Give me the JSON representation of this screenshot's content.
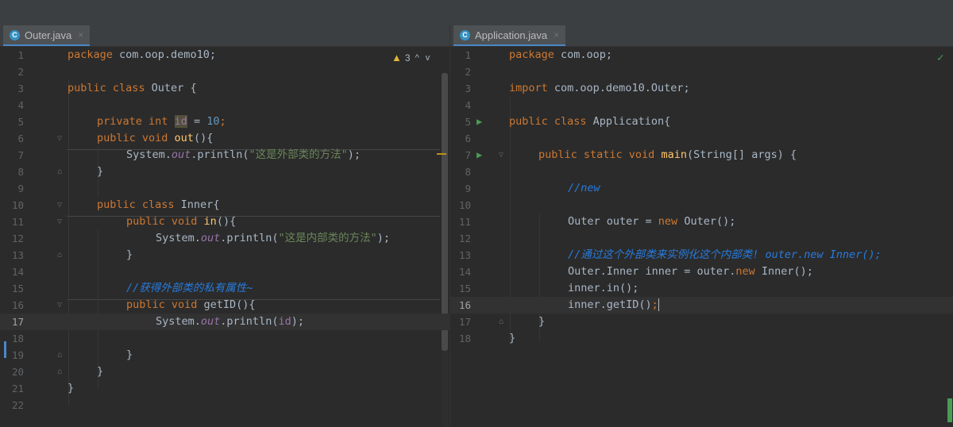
{
  "left_tab": {
    "icon": "C",
    "title": "Outer.java",
    "close": "×"
  },
  "right_tab": {
    "icon": "C",
    "title": "Application.java",
    "close": "×"
  },
  "left_status": {
    "warning_count": "3",
    "up": "^",
    "down": "v"
  },
  "right_status": {
    "check": "✓"
  },
  "left_code": {
    "line_numbers": [
      "1",
      "2",
      "3",
      "4",
      "5",
      "6",
      "7",
      "8",
      "9",
      "10",
      "11",
      "12",
      "13",
      "14",
      "15",
      "16",
      "17",
      "18",
      "19",
      "20",
      "21",
      "22"
    ],
    "l1_kw": "package",
    "l1_rest": " com.oop.demo10;",
    "l3_kw": "public class",
    "l3_rest": " Outer {",
    "l5_kw": "private int",
    "l5_field": "id",
    "l5_eq": " = ",
    "l5_num": "10",
    "l5_end": ";",
    "l6_kw": "public void",
    "l6_fn": "out",
    "l6_end": "(){",
    "l7_a": "System.",
    "l7_out": "out",
    "l7_b": ".println(",
    "l7_str": "\"这是外部类的方法\"",
    "l7_c": ");",
    "l8": "}",
    "l10_kw": "public class",
    "l10_rest": " Inner{",
    "l11_kw": "public void",
    "l11_fn": "in",
    "l11_end": "(){",
    "l12_a": "System.",
    "l12_out": "out",
    "l12_b": ".println(",
    "l12_str": "\"这是内部类的方法\"",
    "l12_c": ");",
    "l13": "}",
    "l15_cmt": "//获得外部类的私有属性~",
    "l16_kw": "public void",
    "l16_rest": " getID(){",
    "l17_a": "System.",
    "l17_out": "out",
    "l17_b": ".println(",
    "l17_field": "id",
    "l17_c": ");",
    "l19": "}",
    "l20": "}",
    "l21": "}"
  },
  "right_code": {
    "line_numbers": [
      "1",
      "2",
      "3",
      "4",
      "5",
      "6",
      "7",
      "8",
      "9",
      "10",
      "11",
      "12",
      "13",
      "14",
      "15",
      "16",
      "17",
      "18"
    ],
    "r1_kw": "package",
    "r1_rest": " com.oop;",
    "r3_kw": "import",
    "r3_rest": " com.oop.demo10.Outer;",
    "r5_kw": "public class",
    "r5_rest": " Application{",
    "r7_kw": "public static void",
    "r7_fn": "main",
    "r7_rest": "(String[] args) {",
    "r9_cmt": "//new",
    "r11_a": "Outer outer = ",
    "r11_kw": "new",
    "r11_b": " Outer();",
    "r13_cmt": "//通过这个外部类来实例化这个内部类! outer.new Inner();",
    "r14_a": "Outer.Inner inner = outer.",
    "r14_kw": "new",
    "r14_b": " Inner();",
    "r15": "inner.in();",
    "r16_a": "inner.getID()",
    "r16_kw": ";",
    "r17": "}",
    "r18": "}"
  }
}
